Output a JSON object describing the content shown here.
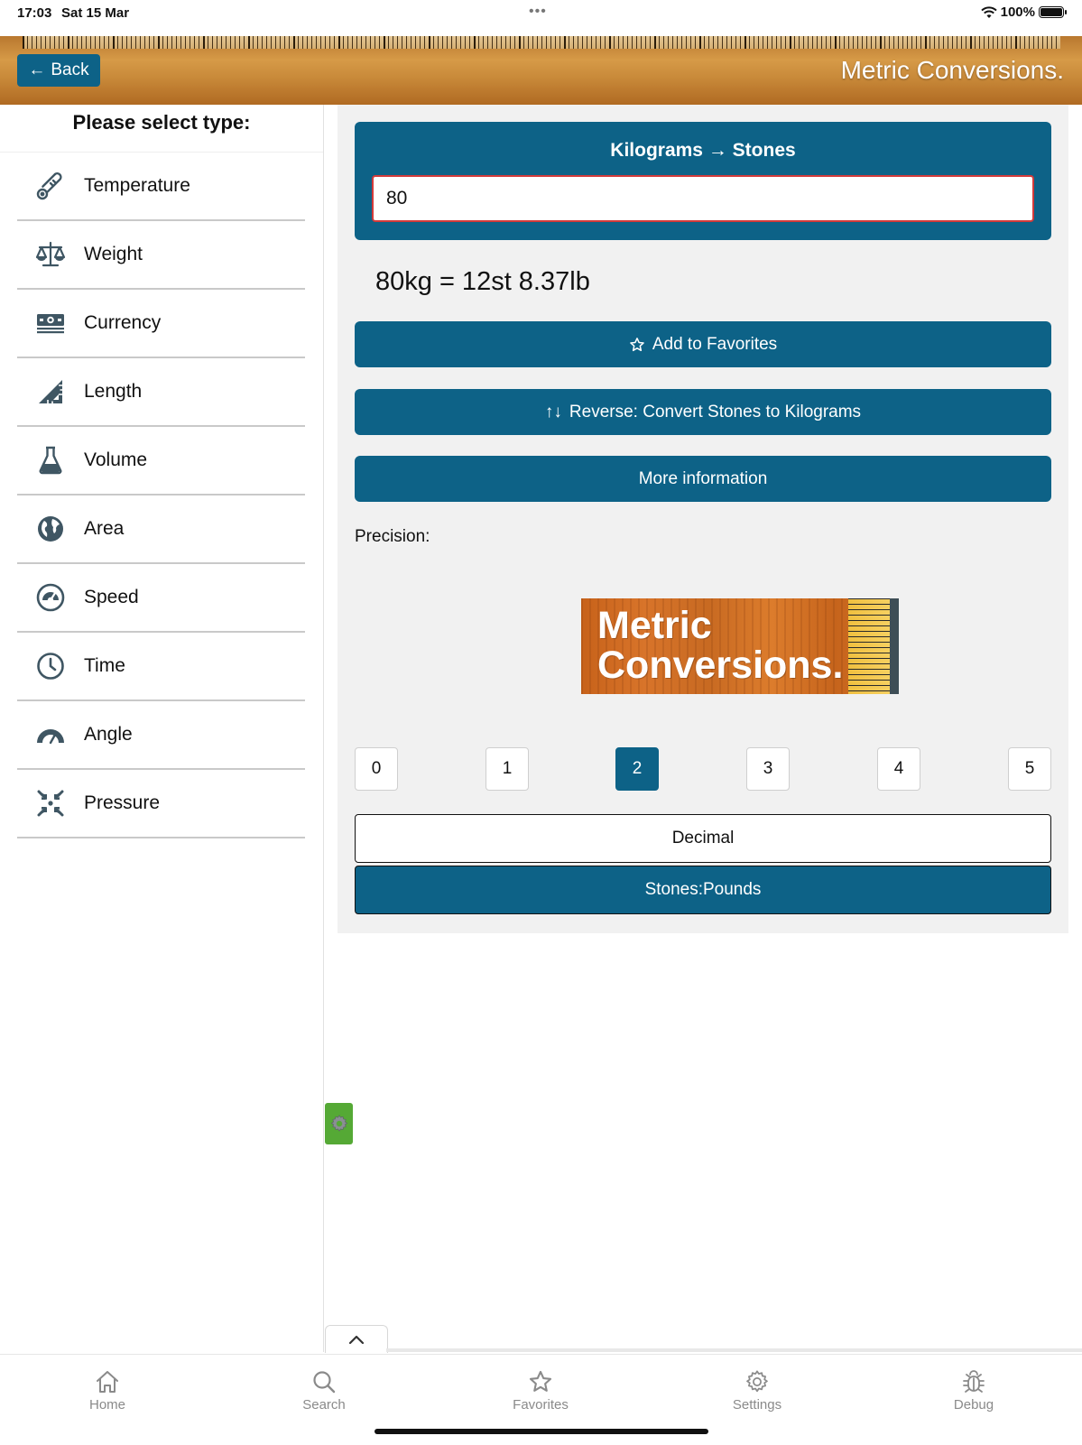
{
  "status": {
    "time": "17:03",
    "date": "Sat 15 Mar",
    "dots": "•••",
    "battery": "100%"
  },
  "header": {
    "back_label": "Back",
    "title": "Metric Conversions."
  },
  "sidebar": {
    "title": "Please select type:",
    "items": [
      {
        "label": "Temperature",
        "icon": "thermometer-icon"
      },
      {
        "label": "Weight",
        "icon": "scales-icon"
      },
      {
        "label": "Currency",
        "icon": "banknote-icon"
      },
      {
        "label": "Length",
        "icon": "ruler-triangle-icon"
      },
      {
        "label": "Volume",
        "icon": "flask-icon"
      },
      {
        "label": "Area",
        "icon": "globe-icon"
      },
      {
        "label": "Speed",
        "icon": "speedometer-icon"
      },
      {
        "label": "Time",
        "icon": "clock-icon"
      },
      {
        "label": "Angle",
        "icon": "protractor-icon"
      },
      {
        "label": "Pressure",
        "icon": "compress-arrows-icon"
      }
    ]
  },
  "converter": {
    "title": "Kilograms → Stones",
    "input_value": "80",
    "result": "80kg = 12st 8.37lb",
    "favorites_label": "Add to Favorites",
    "reverse_label": "Reverse: Convert Stones to Kilograms",
    "more_info_label": "More information",
    "precision_label": "Precision:",
    "precision_options": [
      "0",
      "1",
      "2",
      "3",
      "4",
      "5"
    ],
    "precision_selected": "2",
    "mode_decimal": "Decimal",
    "mode_stones": "Stones:Pounds",
    "mode_selected": "Stones:Pounds"
  },
  "logo": {
    "line1": "Metric",
    "line2": "Conversions."
  },
  "tabbar": [
    {
      "label": "Home",
      "icon": "home-icon"
    },
    {
      "label": "Search",
      "icon": "search-icon"
    },
    {
      "label": "Favorites",
      "icon": "star-icon"
    },
    {
      "label": "Settings",
      "icon": "gear-icon"
    },
    {
      "label": "Debug",
      "icon": "bug-icon"
    }
  ],
  "colors": {
    "primary": "#0d6287",
    "error_border": "#d23a3a",
    "gear_badge": "#55a935"
  }
}
